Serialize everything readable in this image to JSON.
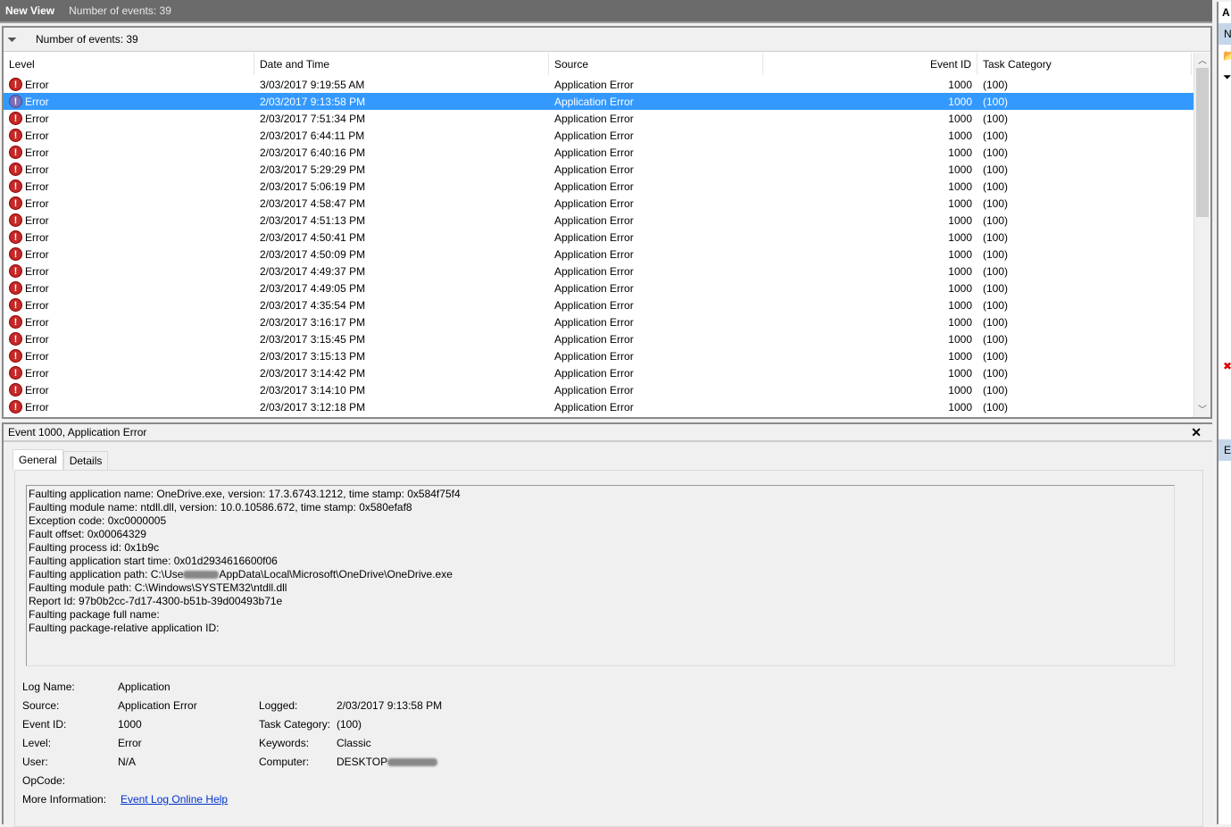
{
  "titlebar": {
    "title": "New View",
    "count": "Number of events: 39"
  },
  "filterbar": {
    "icon": "funnel-icon",
    "text": "Number of events: 39"
  },
  "columns": [
    "Level",
    "Date and Time",
    "Source",
    "Event ID",
    "Task Category"
  ],
  "rows": [
    {
      "level": "Error",
      "date": "3/03/2017 9:19:55 AM",
      "source": "Application Error",
      "id": "1000",
      "cat": "(100)"
    },
    {
      "level": "Error",
      "date": "2/03/2017 9:13:58 PM",
      "source": "Application Error",
      "id": "1000",
      "cat": "(100)",
      "selected": true
    },
    {
      "level": "Error",
      "date": "2/03/2017 7:51:34 PM",
      "source": "Application Error",
      "id": "1000",
      "cat": "(100)"
    },
    {
      "level": "Error",
      "date": "2/03/2017 6:44:11 PM",
      "source": "Application Error",
      "id": "1000",
      "cat": "(100)"
    },
    {
      "level": "Error",
      "date": "2/03/2017 6:40:16 PM",
      "source": "Application Error",
      "id": "1000",
      "cat": "(100)"
    },
    {
      "level": "Error",
      "date": "2/03/2017 5:29:29 PM",
      "source": "Application Error",
      "id": "1000",
      "cat": "(100)"
    },
    {
      "level": "Error",
      "date": "2/03/2017 5:06:19 PM",
      "source": "Application Error",
      "id": "1000",
      "cat": "(100)"
    },
    {
      "level": "Error",
      "date": "2/03/2017 4:58:47 PM",
      "source": "Application Error",
      "id": "1000",
      "cat": "(100)"
    },
    {
      "level": "Error",
      "date": "2/03/2017 4:51:13 PM",
      "source": "Application Error",
      "id": "1000",
      "cat": "(100)"
    },
    {
      "level": "Error",
      "date": "2/03/2017 4:50:41 PM",
      "source": "Application Error",
      "id": "1000",
      "cat": "(100)"
    },
    {
      "level": "Error",
      "date": "2/03/2017 4:50:09 PM",
      "source": "Application Error",
      "id": "1000",
      "cat": "(100)"
    },
    {
      "level": "Error",
      "date": "2/03/2017 4:49:37 PM",
      "source": "Application Error",
      "id": "1000",
      "cat": "(100)"
    },
    {
      "level": "Error",
      "date": "2/03/2017 4:49:05 PM",
      "source": "Application Error",
      "id": "1000",
      "cat": "(100)"
    },
    {
      "level": "Error",
      "date": "2/03/2017 4:35:54 PM",
      "source": "Application Error",
      "id": "1000",
      "cat": "(100)"
    },
    {
      "level": "Error",
      "date": "2/03/2017 3:16:17 PM",
      "source": "Application Error",
      "id": "1000",
      "cat": "(100)"
    },
    {
      "level": "Error",
      "date": "2/03/2017 3:15:45 PM",
      "source": "Application Error",
      "id": "1000",
      "cat": "(100)"
    },
    {
      "level": "Error",
      "date": "2/03/2017 3:15:13 PM",
      "source": "Application Error",
      "id": "1000",
      "cat": "(100)"
    },
    {
      "level": "Error",
      "date": "2/03/2017 3:14:42 PM",
      "source": "Application Error",
      "id": "1000",
      "cat": "(100)"
    },
    {
      "level": "Error",
      "date": "2/03/2017 3:14:10 PM",
      "source": "Application Error",
      "id": "1000",
      "cat": "(100)"
    },
    {
      "level": "Error",
      "date": "2/03/2017 3:12:18 PM",
      "source": "Application Error",
      "id": "1000",
      "cat": "(100)"
    }
  ],
  "detail": {
    "title": "Event 1000, Application Error",
    "tabs": [
      "General",
      "Details"
    ],
    "description": [
      "Faulting application name: OneDrive.exe, version: 17.3.6743.1212, time stamp: 0x584f75f4",
      "Faulting module name: ntdll.dll, version: 10.0.10586.672, time stamp: 0x580efaf8",
      "Exception code: 0xc0000005",
      "Fault offset: 0x00064329",
      "Faulting process id: 0x1b9c",
      "Faulting application start time: 0x01d2934616600f06",
      "Faulting application path: C:\\Use",
      "AppData\\Local\\Microsoft\\OneDrive\\OneDrive.exe",
      "Faulting module path: C:\\Windows\\SYSTEM32\\ntdll.dll",
      "Report Id: 97b0b2cc-7d17-4300-b51b-39d00493b71e",
      "Faulting package full name:",
      "Faulting package-relative application ID:"
    ],
    "props": {
      "log_name_label": "Log Name:",
      "log_name": "Application",
      "source_label": "Source:",
      "source": "Application Error",
      "logged_label": "Logged:",
      "logged": "2/03/2017 9:13:58 PM",
      "event_id_label": "Event ID:",
      "event_id": "1000",
      "task_label": "Task Category:",
      "task": "(100)",
      "level_label": "Level:",
      "level": "Error",
      "keywords_label": "Keywords:",
      "keywords": "Classic",
      "user_label": "User:",
      "user": "N/A",
      "computer_label": "Computer:",
      "computer": "DESKTOP",
      "opcode_label": "OpCode:",
      "more_label": "More Information:",
      "more_link": "Event Log Online Help"
    }
  },
  "actions": {
    "header": "A",
    "section1": "N",
    "section2": "E"
  }
}
